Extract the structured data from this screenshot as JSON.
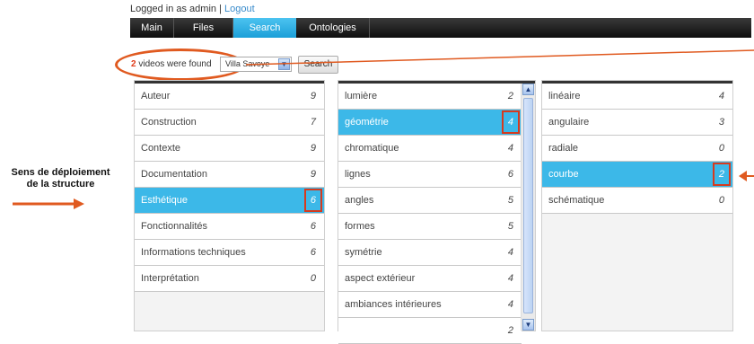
{
  "header": {
    "login_prefix": "Logged in as admin |",
    "logout_label": "Logout"
  },
  "nav": {
    "tabs": [
      {
        "label": "Main"
      },
      {
        "label": "Files"
      },
      {
        "label": "Search",
        "active": true
      },
      {
        "label": "Ontologies"
      }
    ]
  },
  "results": {
    "count": "2",
    "text": "videos were found"
  },
  "search": {
    "selected_value": "Villa Savoye",
    "button_label": "Search"
  },
  "columns": [
    {
      "items": [
        {
          "label": "Auteur",
          "count": "9"
        },
        {
          "label": "Construction",
          "count": "7"
        },
        {
          "label": "Contexte",
          "count": "9"
        },
        {
          "label": "Documentation",
          "count": "9"
        },
        {
          "label": "Esthétique",
          "count": "6",
          "selected": true
        },
        {
          "label": "Fonctionnalités",
          "count": "6"
        },
        {
          "label": "Informations techniques",
          "count": "6"
        },
        {
          "label": "Interprétation",
          "count": "0"
        }
      ]
    },
    {
      "items": [
        {
          "label": "lumière",
          "count": "2"
        },
        {
          "label": "géométrie",
          "count": "4",
          "selected": true
        },
        {
          "label": "chromatique",
          "count": "4"
        },
        {
          "label": "lignes",
          "count": "6"
        },
        {
          "label": "angles",
          "count": "5"
        },
        {
          "label": "formes",
          "count": "5"
        },
        {
          "label": "symétrie",
          "count": "4"
        },
        {
          "label": "aspect extérieur",
          "count": "4"
        },
        {
          "label": "ambiances intérieures",
          "count": "4"
        },
        {
          "label": "",
          "count": "2"
        }
      ]
    },
    {
      "items": [
        {
          "label": "linéaire",
          "count": "4"
        },
        {
          "label": "angulaire",
          "count": "3"
        },
        {
          "label": "radiale",
          "count": "0"
        },
        {
          "label": "courbe",
          "count": "2",
          "selected": true
        },
        {
          "label": "schématique",
          "count": "0"
        }
      ]
    }
  ],
  "annotation": {
    "line1": "Sens de déploiement",
    "line2": "de la structure"
  },
  "colors": {
    "selected_row": "#3cb8e8",
    "highlight": "#d63a1e",
    "arrow": "#e05a20",
    "nav_active": "#1b9fd8"
  }
}
